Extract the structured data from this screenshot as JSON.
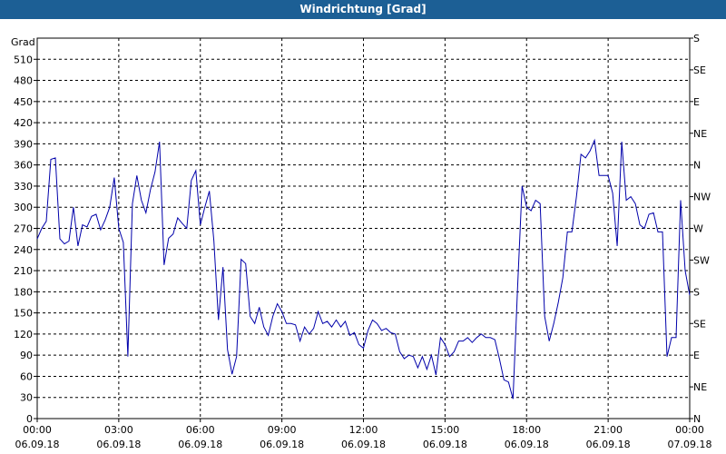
{
  "window": {
    "title": "Windrichtung [Grad]"
  },
  "colors": {
    "title_bar": "#1c5f95",
    "series": "#0000aa",
    "grid": "#000000"
  },
  "chart_data": {
    "type": "line",
    "title": "Windrichtung [Grad]",
    "ylabel": "Grad",
    "ylim": [
      0,
      540
    ],
    "yticks": [
      0,
      30,
      60,
      90,
      120,
      150,
      180,
      210,
      240,
      270,
      300,
      330,
      360,
      390,
      420,
      450,
      480,
      510
    ],
    "y2ticks": [
      {
        "value": 0,
        "label": "N"
      },
      {
        "value": 45,
        "label": "NE"
      },
      {
        "value": 90,
        "label": "E"
      },
      {
        "value": 135,
        "label": "SE"
      },
      {
        "value": 180,
        "label": "S"
      },
      {
        "value": 225,
        "label": "SW"
      },
      {
        "value": 270,
        "label": "W"
      },
      {
        "value": 315,
        "label": "NW"
      },
      {
        "value": 360,
        "label": "N"
      },
      {
        "value": 405,
        "label": "NE"
      },
      {
        "value": 450,
        "label": "E"
      },
      {
        "value": 495,
        "label": "SE"
      },
      {
        "value": 540,
        "label": "S"
      }
    ],
    "xlim": [
      "06.09.18 00:00",
      "07.09.18 00:00"
    ],
    "xticks": [
      {
        "time": "00:00",
        "date": "06.09.18"
      },
      {
        "time": "03:00",
        "date": "06.09.18"
      },
      {
        "time": "06:00",
        "date": "06.09.18"
      },
      {
        "time": "09:00",
        "date": "06.09.18"
      },
      {
        "time": "12:00",
        "date": "06.09.18"
      },
      {
        "time": "15:00",
        "date": "06.09.18"
      },
      {
        "time": "18:00",
        "date": "06.09.18"
      },
      {
        "time": "21:00",
        "date": "06.09.18"
      },
      {
        "time": "00:00",
        "date": "07.09.18"
      }
    ],
    "grid": true,
    "series": [
      {
        "x_hours": [
          0,
          0.1667,
          0.3333,
          0.5,
          0.6667,
          0.8333,
          1,
          1.1667,
          1.3333,
          1.5,
          1.6667,
          1.8333,
          2,
          2.1667,
          2.3333,
          2.5,
          2.6667,
          2.8333,
          3,
          3.1667,
          3.3333,
          3.5,
          3.6667,
          3.8333,
          4,
          4.1667,
          4.3333,
          4.5,
          4.6667,
          4.8333,
          5,
          5.1667,
          5.3333,
          5.5,
          5.6667,
          5.8333,
          6,
          6.1667,
          6.3333,
          6.5,
          6.6667,
          6.8333,
          7,
          7.1667,
          7.3333,
          7.5,
          7.6667,
          7.8333,
          8,
          8.1667,
          8.3333,
          8.5,
          8.6667,
          8.8333,
          9,
          9.1667,
          9.3333,
          9.5,
          9.6667,
          9.8333,
          10,
          10.1667,
          10.3333,
          10.5,
          10.6667,
          10.8333,
          11,
          11.1667,
          11.3333,
          11.5,
          11.6667,
          11.8333,
          12,
          12.1667,
          12.3333,
          12.5,
          12.6667,
          12.8333,
          13,
          13.1667,
          13.3333,
          13.5,
          13.6667,
          13.8333,
          14,
          14.1667,
          14.3333,
          14.5,
          14.6667,
          14.8333,
          15,
          15.1667,
          15.3333,
          15.5,
          15.6667,
          15.8333,
          16,
          16.1667,
          16.3333,
          16.5,
          16.6667,
          16.8333,
          17,
          17.1667,
          17.3333,
          17.5,
          17.6667,
          17.8333,
          18,
          18.1667,
          18.3333,
          18.5,
          18.6667,
          18.8333,
          19,
          19.1667,
          19.3333,
          19.5,
          19.6667,
          19.8333,
          20,
          20.1667,
          20.3333,
          20.5,
          20.6667,
          20.8333,
          21,
          21.1667,
          21.3333,
          21.5,
          21.6667,
          21.8333,
          22,
          22.1667,
          22.3333,
          22.5,
          22.6667,
          22.8333,
          23,
          23.1667,
          23.3333,
          23.5,
          23.6667,
          23.8333,
          24
        ],
        "values": [
          255,
          270,
          280,
          368,
          370,
          255,
          248,
          252,
          300,
          245,
          275,
          272,
          287,
          290,
          268,
          282,
          300,
          342,
          270,
          250,
          88,
          305,
          345,
          310,
          292,
          325,
          350,
          393,
          218,
          256,
          262,
          285,
          277,
          270,
          338,
          352,
          275,
          300,
          323,
          252,
          140,
          215,
          98,
          63,
          88,
          226,
          220,
          145,
          135,
          158,
          130,
          118,
          145,
          163,
          152,
          135,
          135,
          133,
          110,
          130,
          120,
          128,
          152,
          135,
          138,
          130,
          140,
          130,
          138,
          118,
          122,
          105,
          100,
          125,
          140,
          135,
          125,
          128,
          122,
          120,
          95,
          85,
          90,
          88,
          72,
          88,
          70,
          90,
          62,
          115,
          105,
          88,
          95,
          110,
          110,
          115,
          108,
          115,
          120,
          115,
          115,
          112,
          85,
          55,
          52,
          28,
          185,
          330,
          300,
          295,
          310,
          305,
          145,
          110,
          135,
          165,
          200,
          265,
          265,
          315,
          375,
          370,
          380,
          395,
          345,
          345,
          345,
          320,
          245,
          393,
          310,
          315,
          305,
          275,
          270,
          290,
          292,
          265,
          265,
          88,
          115,
          115,
          310,
          210,
          175
        ]
      }
    ]
  }
}
